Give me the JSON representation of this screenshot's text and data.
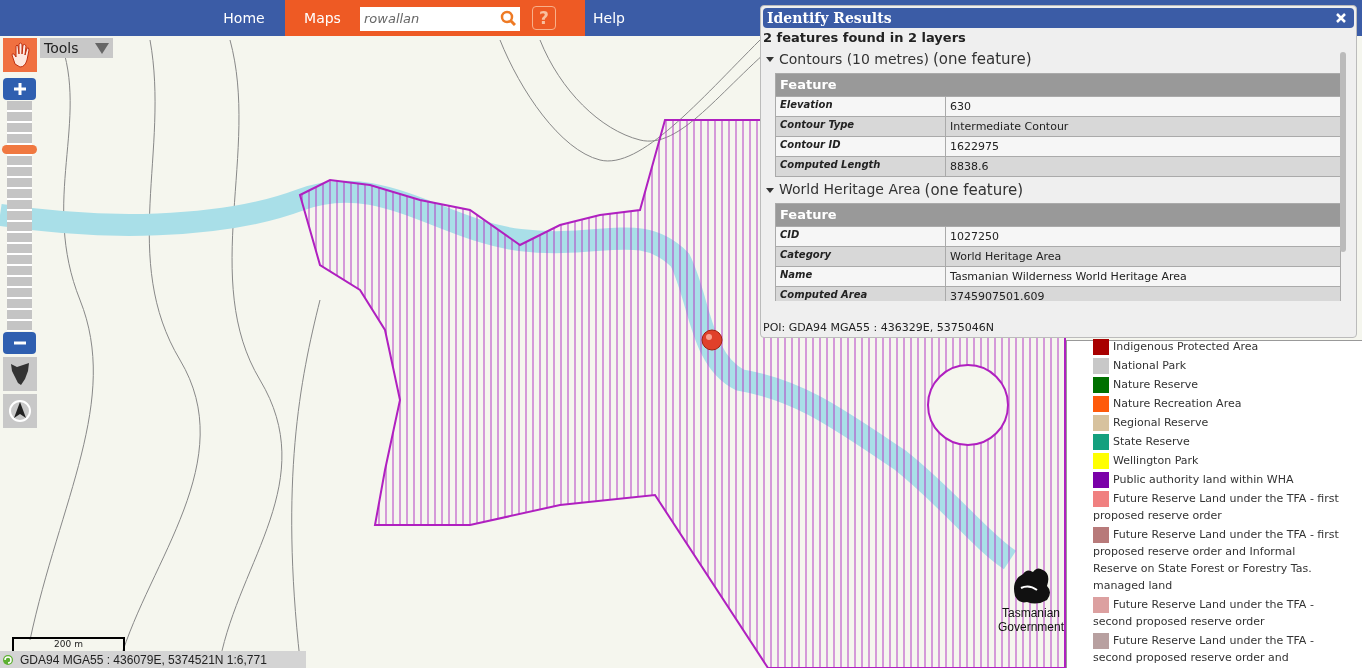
{
  "nav": {
    "tabs": [
      {
        "label": "Home",
        "selected": false
      },
      {
        "label": "Maps",
        "selected": true
      }
    ],
    "search": {
      "value": "rowallan"
    },
    "help_button": "?",
    "help_link": "Help"
  },
  "tools": {
    "label": "Tools"
  },
  "zoom": {
    "level": 0.8
  },
  "layer_panel": {
    "legend": [
      {
        "label": "Indigenous Protected Area",
        "color": "#a80000"
      },
      {
        "label": "National Park",
        "color": "#c8c8c8"
      },
      {
        "label": "Nature Reserve",
        "color": "#007000"
      },
      {
        "label": "Nature Recreation Area",
        "color": "#ff5a0a"
      },
      {
        "label": "Regional Reserve",
        "color": "#d7c29e"
      },
      {
        "label": "State Reserve",
        "color": "#14a07e"
      },
      {
        "label": "Wellington Park",
        "color": "#ffff00"
      },
      {
        "label": "Public authority land within WHA",
        "color": "#7a00a8"
      },
      {
        "label": "Future Reserve Land under the TFA - first proposed reserve order",
        "color": "#f08080"
      },
      {
        "label": "Future Reserve Land under the TFA - first proposed reserve order and Informal Reserve on State Forest or Forestry Tas. managed land",
        "color": "#b87a7a"
      },
      {
        "label": "Future Reserve Land under the TFA - second proposed reserve order",
        "color": "#dca0a0"
      },
      {
        "label": "Future Reserve Land under the TFA - second proposed reserve order and",
        "color": "#b8a0a0"
      }
    ]
  },
  "identify": {
    "title": "Identify Results",
    "summary": "2 features found in 2 layers",
    "layers": [
      {
        "name": "Contours (10 metres)",
        "count": "(one feature)",
        "expanded": true,
        "header": "Feature",
        "rows": [
          {
            "field": "Elevation",
            "value": "630"
          },
          {
            "field": "Contour Type",
            "value": "Intermediate Contour"
          },
          {
            "field": "Contour ID",
            "value": "1622975"
          },
          {
            "field": "Computed Length",
            "value": "8838.6"
          }
        ]
      },
      {
        "name": "World Heritage Area",
        "count": "(one feature)",
        "expanded": true,
        "header": "Feature",
        "rows": [
          {
            "field": "CID",
            "value": "1027250"
          },
          {
            "field": "Category",
            "value": "World Heritage Area"
          },
          {
            "field": "Name",
            "value": "Tasmanian Wilderness World Heritage Area"
          },
          {
            "field": "Computed Area",
            "value": "3745907501.609"
          }
        ]
      }
    ],
    "poi": "POI: GDA94 MGA55 : 436329E, 5375046N"
  },
  "logo_text": "Tasmanian Government",
  "scale": "200 m",
  "status": "GDA94 MGA55 : 436079E, 5374521N 1:6,771"
}
